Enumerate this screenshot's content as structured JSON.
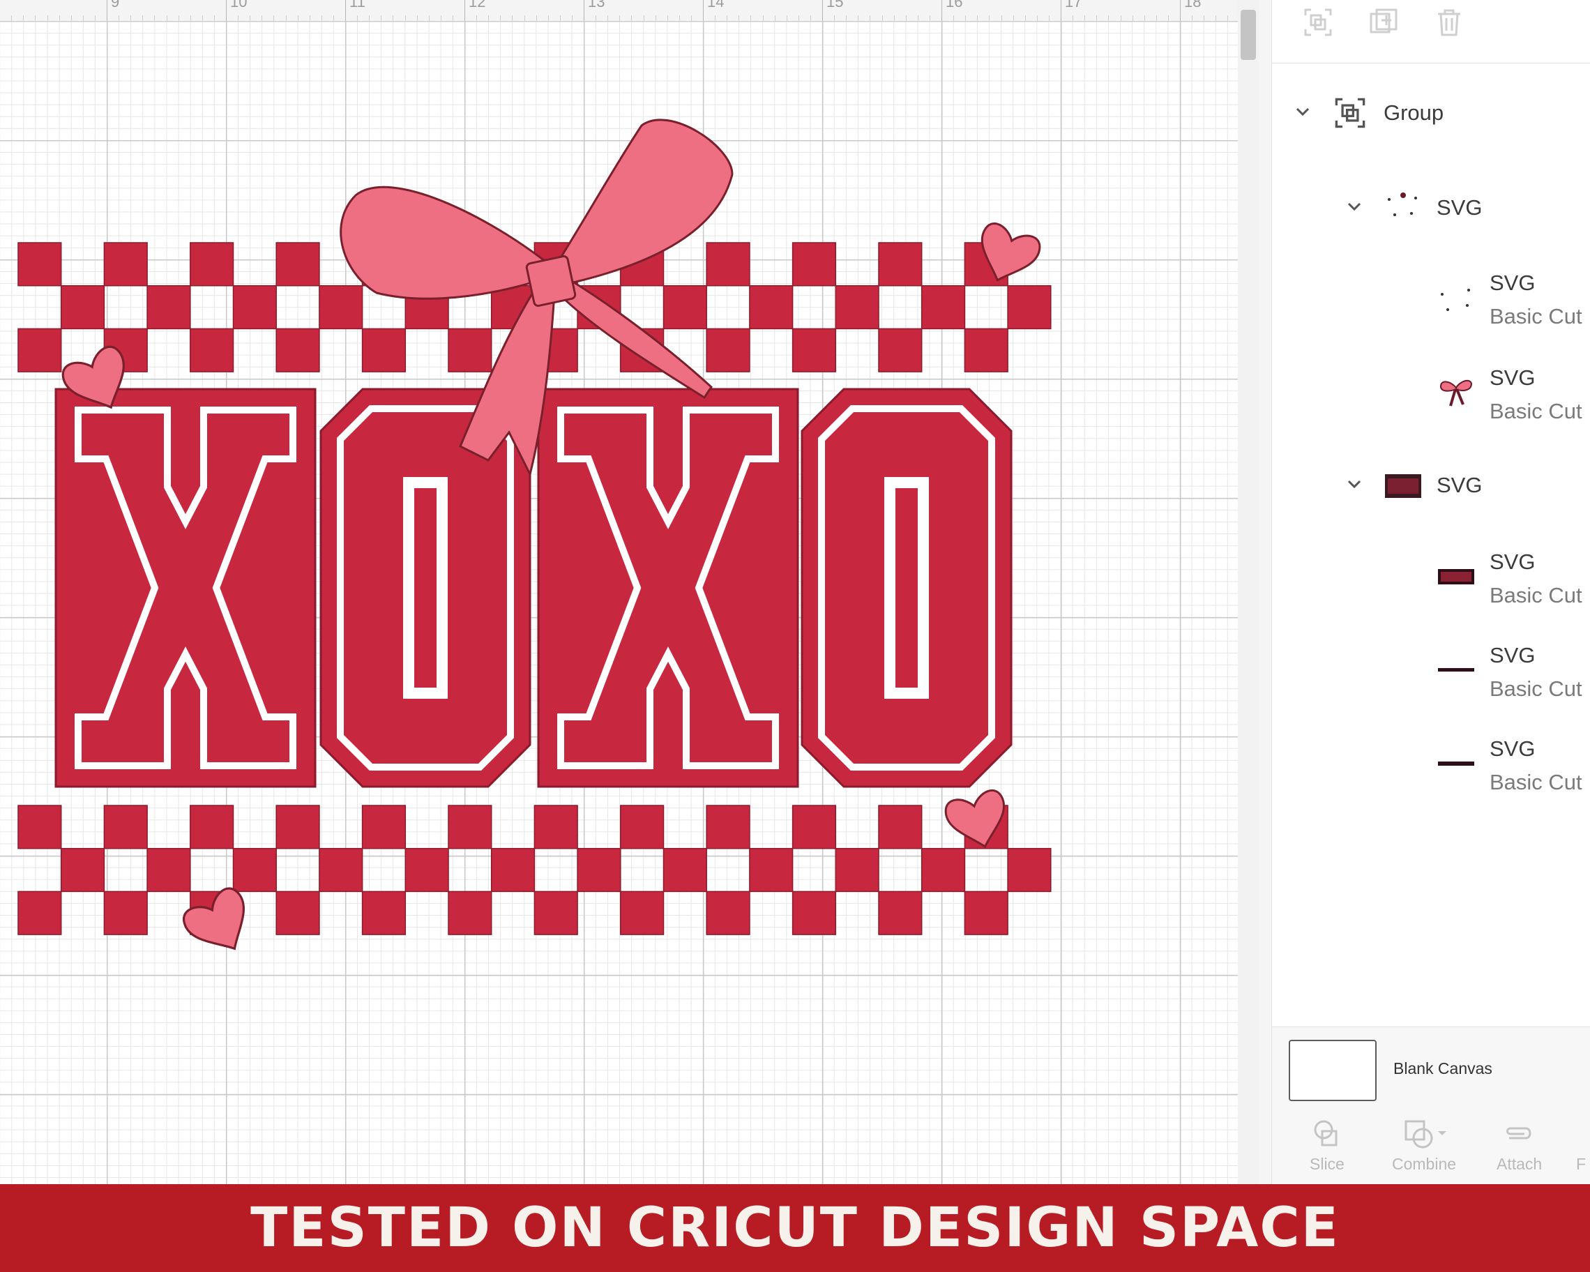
{
  "ruler": {
    "labels": [
      "9",
      "10",
      "11",
      "12",
      "13",
      "14",
      "15",
      "16",
      "17",
      "18"
    ]
  },
  "design": {
    "text": "XOXO",
    "colors": {
      "red": "#c8283f",
      "pink": "#ef6f82",
      "outline": "#8a1a2c"
    }
  },
  "panel": {
    "toolbar_icons": [
      "group-icon",
      "duplicate-icon",
      "delete-icon"
    ],
    "group": {
      "label": "Group",
      "icon": "group-icon"
    },
    "svg_a": {
      "label": "SVG",
      "children": [
        {
          "title": "SVG",
          "subtitle": "Basic Cut"
        },
        {
          "title": "SVG",
          "subtitle": "Basic Cut"
        }
      ]
    },
    "svg_b": {
      "label": "SVG",
      "children": [
        {
          "title": "SVG",
          "subtitle": "Basic Cut"
        },
        {
          "title": "SVG",
          "subtitle": "Basic Cut"
        },
        {
          "title": "SVG",
          "subtitle": "Basic Cut"
        }
      ]
    },
    "blank_canvas": {
      "label": "Blank Canvas"
    },
    "actions": [
      {
        "label": "Slice",
        "icon": "slice-icon"
      },
      {
        "label": "Combine",
        "icon": "combine-icon"
      },
      {
        "label": "Attach",
        "icon": "attach-icon"
      },
      {
        "label": "F",
        "icon": "flatten-icon"
      }
    ]
  },
  "banner": {
    "text": "TESTED ON CRICUT DESIGN SPACE"
  }
}
